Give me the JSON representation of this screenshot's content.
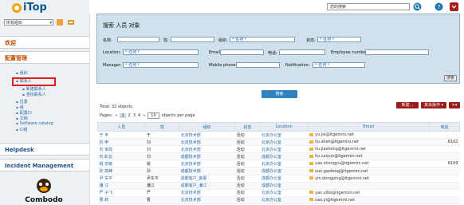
{
  "app": {
    "logo": "iTop",
    "org_select": "所有组织"
  },
  "sidebar": {
    "sections": [
      {
        "label": "欢迎"
      },
      {
        "label": "配置管理"
      },
      {
        "label": "Helpdesk"
      },
      {
        "label": "Incident Management"
      }
    ],
    "items": [
      {
        "label": "组织"
      },
      {
        "label": "联系人"
      },
      {
        "label": "新建联系人"
      },
      {
        "label": "查找联系人"
      },
      {
        "label": "位置"
      },
      {
        "label": "组"
      },
      {
        "label": "配置CI"
      },
      {
        "label": "文档"
      },
      {
        "label": "Software catalog"
      },
      {
        "label": "CI组"
      }
    ],
    "footer_logo": "Combodo"
  },
  "topbar": {
    "search_placeholder": "您的搜索"
  },
  "search": {
    "title": "搜索 人员 对象",
    "labels": {
      "name": "名称:",
      "surname": "姓:",
      "org": "组织:",
      "status": "状态:",
      "location": "Location:",
      "email": "Email:",
      "phone": "电话:",
      "employee": "Employee number:",
      "manager": "Manager:",
      "mobile": "Mobile phone:",
      "notification": "Notification:"
    },
    "any": "* 任何 *",
    "button": "搜索"
  },
  "tab_label": "搜索",
  "results": {
    "total": "Total: 32 objects.",
    "pages_label": "Pages:",
    "pages": [
      "1",
      "2",
      "3",
      "4"
    ],
    "per_page_value": "10",
    "per_page_suffix": "objects per page",
    "new_button": "新建...",
    "other_actions": "其余操作 ▾",
    "tools": "✕▾",
    "columns": [
      "人员",
      "姓",
      "组织",
      "状态",
      "Location",
      "Email",
      "电话"
    ],
    "rows": [
      [
        "于 丰",
        "于",
        "北京技术部",
        "活动",
        "北京办公室",
        "yu.jie@itgemini.net",
        ""
      ],
      [
        "刘 申",
        "刘",
        "北京技术部",
        "活动",
        "北京办公室",
        "liu.shen@itgemini.net",
        "6102"
      ],
      [
        "刘 家政",
        "刘",
        "北京技术部",
        "活动",
        "北京办公室",
        "liu.jiazheng@itgemini.net",
        ""
      ],
      [
        "刘 彩云",
        "刘",
        "成都技术部",
        "活动",
        "成都办公室",
        "liu.caiyun@itgemini.net",
        ""
      ],
      [
        "姚 忠敏",
        "姚",
        "北京技术部",
        "活动",
        "北京办公室",
        "yao.zhongyu@itgemini.net",
        "8109"
      ],
      [
        "孙 高峰",
        "孙",
        "成都技术部",
        "活动",
        "成都办公室",
        "sun.gaofeng@itgemini.net",
        ""
      ],
      [
        "尹 东平",
        "尹东平",
        "成都客户_客服",
        "活动",
        "成都办公室",
        "yin.dongping@itgemini.net",
        ""
      ],
      [
        "潘 江",
        "潘江",
        "成都客户_潘江",
        "活动",
        "成都办公室",
        "",
        ""
      ],
      [
        "严 子飞",
        "严",
        "北京技术部",
        "活动",
        "北京办公室",
        "yan.zifei@itgemini.net",
        ""
      ],
      [
        "曹 莉",
        "曹",
        "北京技术部",
        "活动",
        "北京办公室",
        "cao.yi@itgemini.net",
        ""
      ]
    ]
  }
}
